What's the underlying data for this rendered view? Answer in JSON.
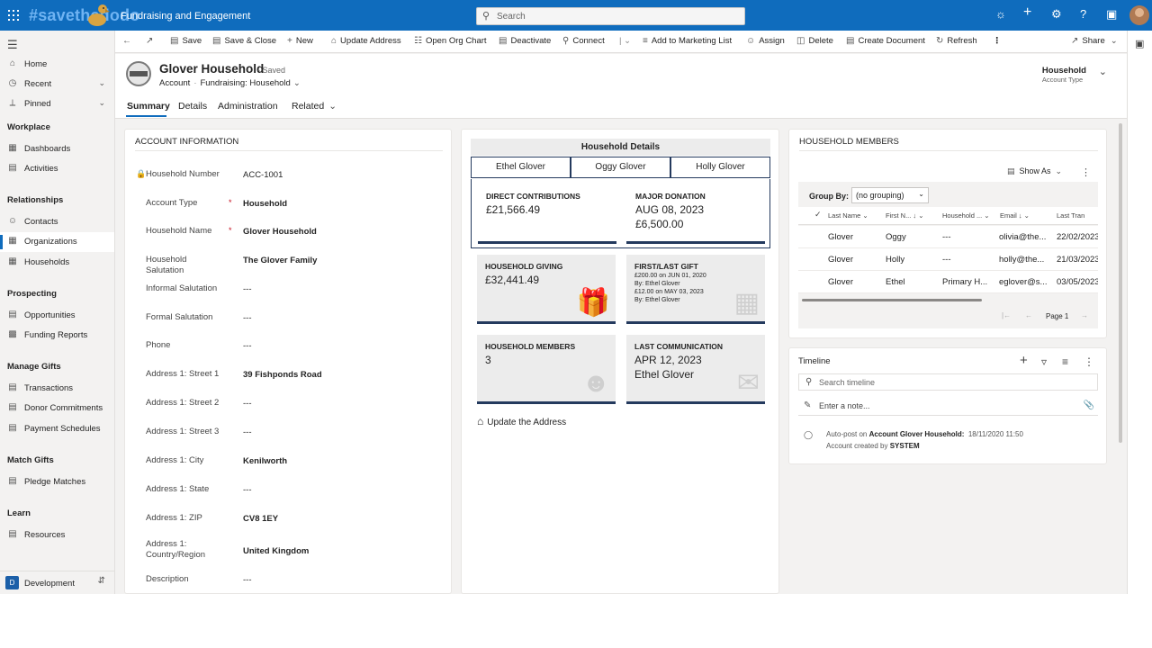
{
  "topbar": {
    "brand": "#savethedodo",
    "app_title": "Fundraising and Engagement",
    "search_placeholder": "Search",
    "icons": [
      "lightbulb-icon",
      "plus-icon",
      "gear-icon",
      "help-icon",
      "chat-icon"
    ]
  },
  "sidebar": {
    "items_top": [
      {
        "label": "Home",
        "icon": "home-icon"
      },
      {
        "label": "Recent",
        "icon": "clock-icon"
      },
      {
        "label": "Pinned",
        "icon": "pin-icon"
      }
    ],
    "sections": [
      {
        "title": "Workplace",
        "items": [
          {
            "label": "Dashboards"
          },
          {
            "label": "Activities"
          }
        ]
      },
      {
        "title": "Relationships",
        "items": [
          {
            "label": "Contacts"
          },
          {
            "label": "Organizations"
          },
          {
            "label": "Households"
          }
        ]
      },
      {
        "title": "Prospecting",
        "items": [
          {
            "label": "Opportunities"
          },
          {
            "label": "Funding Reports"
          }
        ]
      },
      {
        "title": "Manage Gifts",
        "items": [
          {
            "label": "Transactions"
          },
          {
            "label": "Donor Commitments"
          },
          {
            "label": "Payment Schedules"
          }
        ]
      },
      {
        "title": "Match Gifts",
        "items": [
          {
            "label": "Pledge Matches"
          }
        ]
      },
      {
        "title": "Learn",
        "items": [
          {
            "label": "Resources"
          }
        ]
      }
    ],
    "area_badge": "D",
    "area_label": "Development"
  },
  "commands": {
    "save": "Save",
    "save_close": "Save & Close",
    "new": "New",
    "update_address": "Update Address",
    "open_org_chart": "Open Org Chart",
    "deactivate": "Deactivate",
    "connect": "Connect",
    "add_marketing": "Add to Marketing List",
    "assign": "Assign",
    "delete": "Delete",
    "create_document": "Create Document",
    "refresh": "Refresh",
    "share": "Share"
  },
  "record": {
    "title": "Glover Household",
    "saved": "- Saved",
    "entity": "Account",
    "form": "Fundraising: Household",
    "header_value": "Household",
    "header_label": "Account Type",
    "tabs": [
      "Summary",
      "Details",
      "Administration",
      "Related"
    ]
  },
  "account_info": {
    "title": "ACCOUNT INFORMATION",
    "fields": [
      {
        "label": "Household Number",
        "value": "ACC-1001"
      },
      {
        "label": "Account Type",
        "value": "Household"
      },
      {
        "label": "Household Name",
        "value": "Glover Household"
      },
      {
        "label": "Household Salutation",
        "value": "The Glover Family"
      },
      {
        "label": "Informal Salutation",
        "value": "---"
      },
      {
        "label": "Formal Salutation",
        "value": "---"
      },
      {
        "label": "Phone",
        "value": "---"
      },
      {
        "label": "Address 1: Street 1",
        "value": "39 Fishponds Road"
      },
      {
        "label": "Address 1: Street 2",
        "value": "---"
      },
      {
        "label": "Address 1: Street 3",
        "value": "---"
      },
      {
        "label": "Address 1: City",
        "value": "Kenilworth"
      },
      {
        "label": "Address 1: State",
        "value": "---"
      },
      {
        "label": "Address 1: ZIP",
        "value": "CV8 1EY"
      },
      {
        "label": "Address 1: Country/Region",
        "value": "United Kingdom"
      },
      {
        "label": "Description",
        "value": "---"
      }
    ]
  },
  "household_details": {
    "title": "Household Details",
    "members": [
      "Ethel Glover",
      "Oggy Glover",
      "Holly Glover"
    ],
    "direct_title": "DIRECT CONTRIBUTIONS",
    "direct_value": "£21,566.49",
    "major_title": "MAJOR DONATION",
    "major_date": "AUG 08, 2023",
    "major_value": "£6,500.00",
    "giving_title": "HOUSEHOLD GIVING",
    "giving_value": "£32,441.49",
    "gift_title": "FIRST/LAST GIFT",
    "gift_first": "£200.00 on JUN 01, 2020",
    "gift_first_by": "By: Ethel Glover",
    "gift_last": "£12.00 on MAY 03, 2023",
    "gift_last_by": "By: Ethel Glover",
    "members_title": "HOUSEHOLD MEMBERS",
    "members_value": "3",
    "comm_title": "LAST COMMUNICATION",
    "comm_date": "APR 12, 2023",
    "comm_by": "Ethel Glover",
    "update_link": "Update the Address"
  },
  "members_grid": {
    "title": "HOUSEHOLD MEMBERS",
    "show_as": "Show As",
    "group_by_label": "Group By:",
    "group_by_value": "(no grouping)",
    "columns": [
      "Last Name",
      "First N...",
      "Household ...",
      "Email",
      "Last Tran"
    ],
    "rows": [
      [
        "Glover",
        "Oggy",
        "---",
        "olivia@the...",
        "22/02/2023"
      ],
      [
        "Glover",
        "Holly",
        "---",
        "holly@the...",
        "21/03/2023"
      ],
      [
        "Glover",
        "Ethel",
        "Primary H...",
        "eglover@s...",
        "03/05/2023"
      ]
    ],
    "page": "Page 1"
  },
  "timeline": {
    "title": "Timeline",
    "search_placeholder": "Search timeline",
    "note_placeholder": "Enter a note...",
    "post_prefix": "Auto-post on",
    "post_account": "Account Glover Household:",
    "post_time": "18/11/2020 11:50",
    "post_body": "Account created by",
    "post_user": "SYSTEM"
  }
}
